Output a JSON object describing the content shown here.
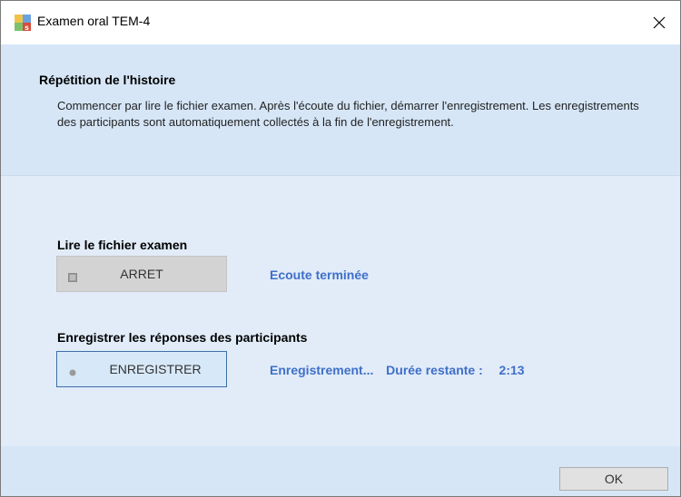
{
  "window": {
    "title": "Examen oral TEM-4",
    "close_glyph": "✕",
    "icon": "app-icon"
  },
  "header": {
    "title": "Répétition de l'histoire",
    "description": "Commencer par lire le fichier examen. Après l'écoute du fichier, démarrer l'enregistrement. Les enregistrements des participants sont automatiquement collectés à la fin de l'enregistrement."
  },
  "playback": {
    "label": "Lire le fichier examen",
    "button_label": "ARRET",
    "button_icon": "stop-square-icon",
    "status": "Ecoute terminée"
  },
  "recording": {
    "label": "Enregistrer les réponses des participants",
    "button_label": "ENREGISTRER",
    "button_icon": "record-dot-icon",
    "status_prefix": "Enregistrement...",
    "remaining_label": "Durée restante :",
    "remaining_time": "2:13"
  },
  "footer": {
    "ok_label": "OK"
  },
  "colors": {
    "header_band": "#d6e6f7",
    "content_bg": "#e1ecf8",
    "status_text": "#3f6fc9",
    "record_border": "#3d6fa8"
  }
}
